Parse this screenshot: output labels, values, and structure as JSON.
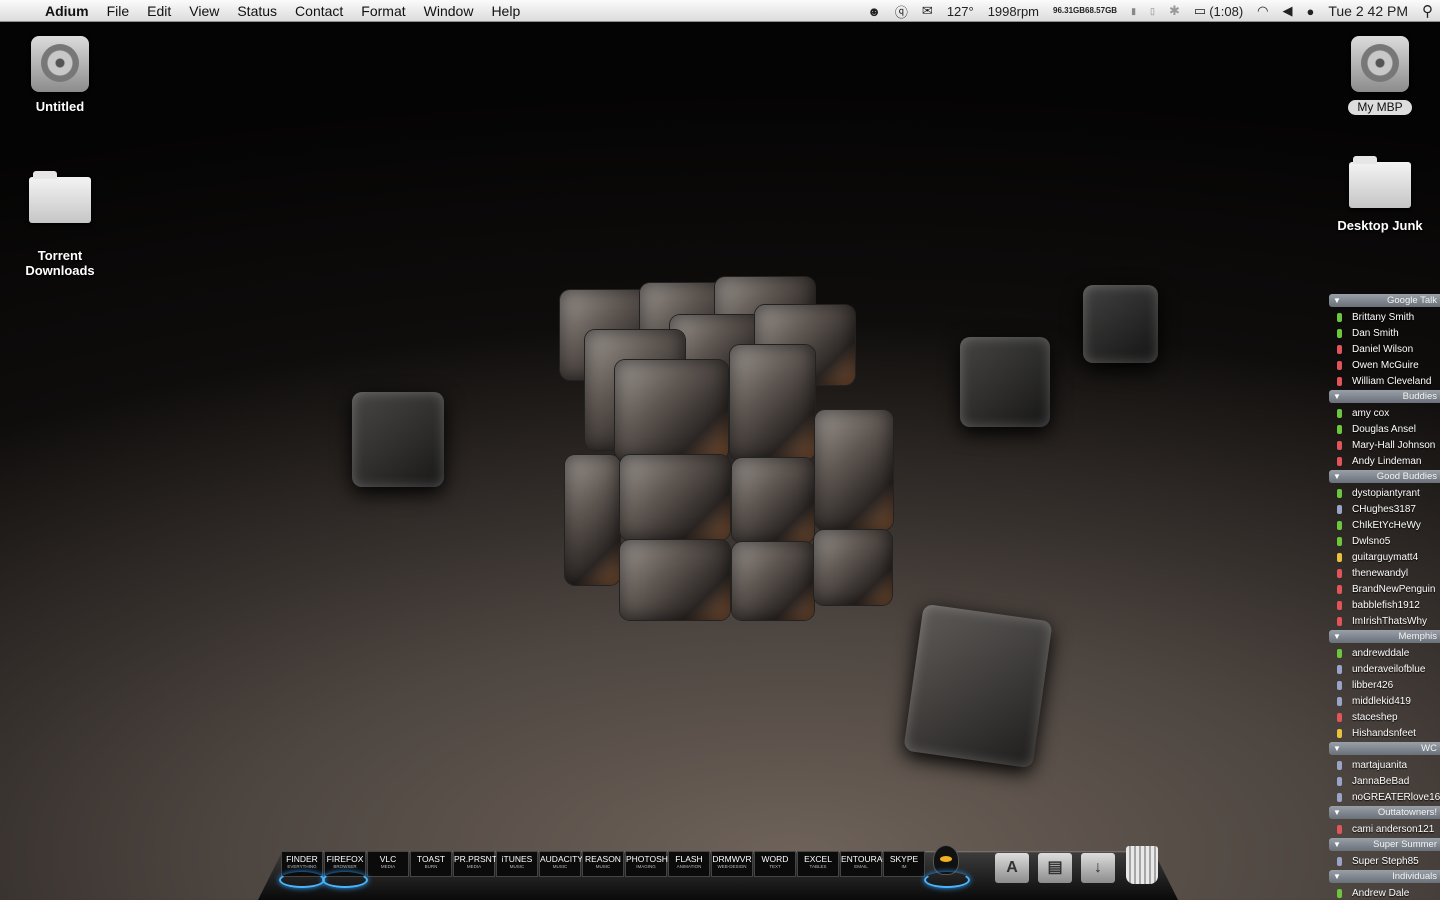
{
  "menubar": {
    "app_name": "Adium",
    "items": [
      "File",
      "Edit",
      "View",
      "Status",
      "Contact",
      "Format",
      "Window",
      "Help"
    ],
    "temperature": "127°",
    "fan": "1998rpm",
    "disk_used": "96.31GB",
    "disk_free": "68.57GB",
    "battery": "(1:08)",
    "clock": "Tue 2 42 PM"
  },
  "desktop": {
    "icons": [
      {
        "label": "Untitled",
        "kind": "hard-drive"
      },
      {
        "label": "Torrent\nDownloads",
        "kind": "folder"
      },
      {
        "label": "My MBP",
        "kind": "hard-drive"
      },
      {
        "label": "Desktop Junk",
        "kind": "folder"
      }
    ]
  },
  "buddylist": {
    "groups": [
      {
        "name": "Google Talk",
        "buddies": [
          {
            "name": "Brittany Smith",
            "status": "available"
          },
          {
            "name": "Dan Smith",
            "status": "available"
          },
          {
            "name": "Daniel Wilson",
            "status": "away"
          },
          {
            "name": "Owen McGuire",
            "status": "away"
          },
          {
            "name": "William Cleveland",
            "status": "away"
          }
        ]
      },
      {
        "name": "Buddies",
        "buddies": [
          {
            "name": "amy cox",
            "status": "available"
          },
          {
            "name": "Douglas Ansel",
            "status": "available"
          },
          {
            "name": "Mary-Hall Johnson",
            "status": "away"
          },
          {
            "name": "Andy Lindeman",
            "status": "away"
          }
        ]
      },
      {
        "name": "Good Buddies",
        "buddies": [
          {
            "name": "dystopiantyrant",
            "status": "available"
          },
          {
            "name": "CHughes3187",
            "status": "mobile"
          },
          {
            "name": "ChIkEtYcHeWy",
            "status": "available"
          },
          {
            "name": "Dwlsno5",
            "status": "available"
          },
          {
            "name": "guitarguymatt4",
            "status": "idle"
          },
          {
            "name": "thenewandyl",
            "status": "away"
          },
          {
            "name": "BrandNewPenguin",
            "status": "away"
          },
          {
            "name": "babblefish1912",
            "status": "away"
          },
          {
            "name": "ImIrishThatsWhy",
            "status": "away"
          }
        ]
      },
      {
        "name": "Memphis",
        "buddies": [
          {
            "name": "andrewddale",
            "status": "available"
          },
          {
            "name": "underaveilofblue",
            "status": "mobile"
          },
          {
            "name": "libber426",
            "status": "mobile"
          },
          {
            "name": "middlekid419",
            "status": "mobile"
          },
          {
            "name": "staceshep",
            "status": "away"
          },
          {
            "name": "Hishandsnfeet",
            "status": "idle"
          }
        ]
      },
      {
        "name": "WC",
        "buddies": [
          {
            "name": "martajuanita",
            "status": "mobile"
          },
          {
            "name": "JannaBeBad",
            "status": "mobile"
          },
          {
            "name": "noGREATERlove16",
            "status": "mobile"
          }
        ]
      },
      {
        "name": "Outtatowners!",
        "buddies": [
          {
            "name": "cami anderson121",
            "status": "away"
          }
        ]
      },
      {
        "name": "Super Summer",
        "buddies": [
          {
            "name": "Super Steph85",
            "status": "mobile"
          }
        ]
      },
      {
        "name": "Individuals",
        "buddies": [
          {
            "name": "Andrew Dale",
            "status": "available"
          }
        ]
      }
    ]
  },
  "dock": {
    "apps": [
      {
        "label": "FINDER",
        "sub": "EVERYTHING"
      },
      {
        "label": "FIREFOX",
        "sub": "BROWSER"
      },
      {
        "label": "VLC",
        "sub": "MEDIA"
      },
      {
        "label": "TOAST",
        "sub": "BURN"
      },
      {
        "label": "PR.PRSNTR",
        "sub": "MEDIA"
      },
      {
        "label": "iTUNES",
        "sub": "MUSIC"
      },
      {
        "label": "AUDACITY",
        "sub": "MUSIC"
      },
      {
        "label": "REASON",
        "sub": "MUSIC"
      },
      {
        "label": "PHOTOSHP",
        "sub": "IMAGING"
      },
      {
        "label": "FLASH",
        "sub": "ANIMATION"
      },
      {
        "label": "DRMWVR",
        "sub": "WEB-DESIGN"
      },
      {
        "label": "WORD",
        "sub": "TEXT"
      },
      {
        "label": "EXCEL",
        "sub": "TABLES"
      },
      {
        "label": "ENTOURAGE",
        "sub": "EMAIL"
      },
      {
        "label": "SKYPE",
        "sub": "IM"
      }
    ]
  }
}
